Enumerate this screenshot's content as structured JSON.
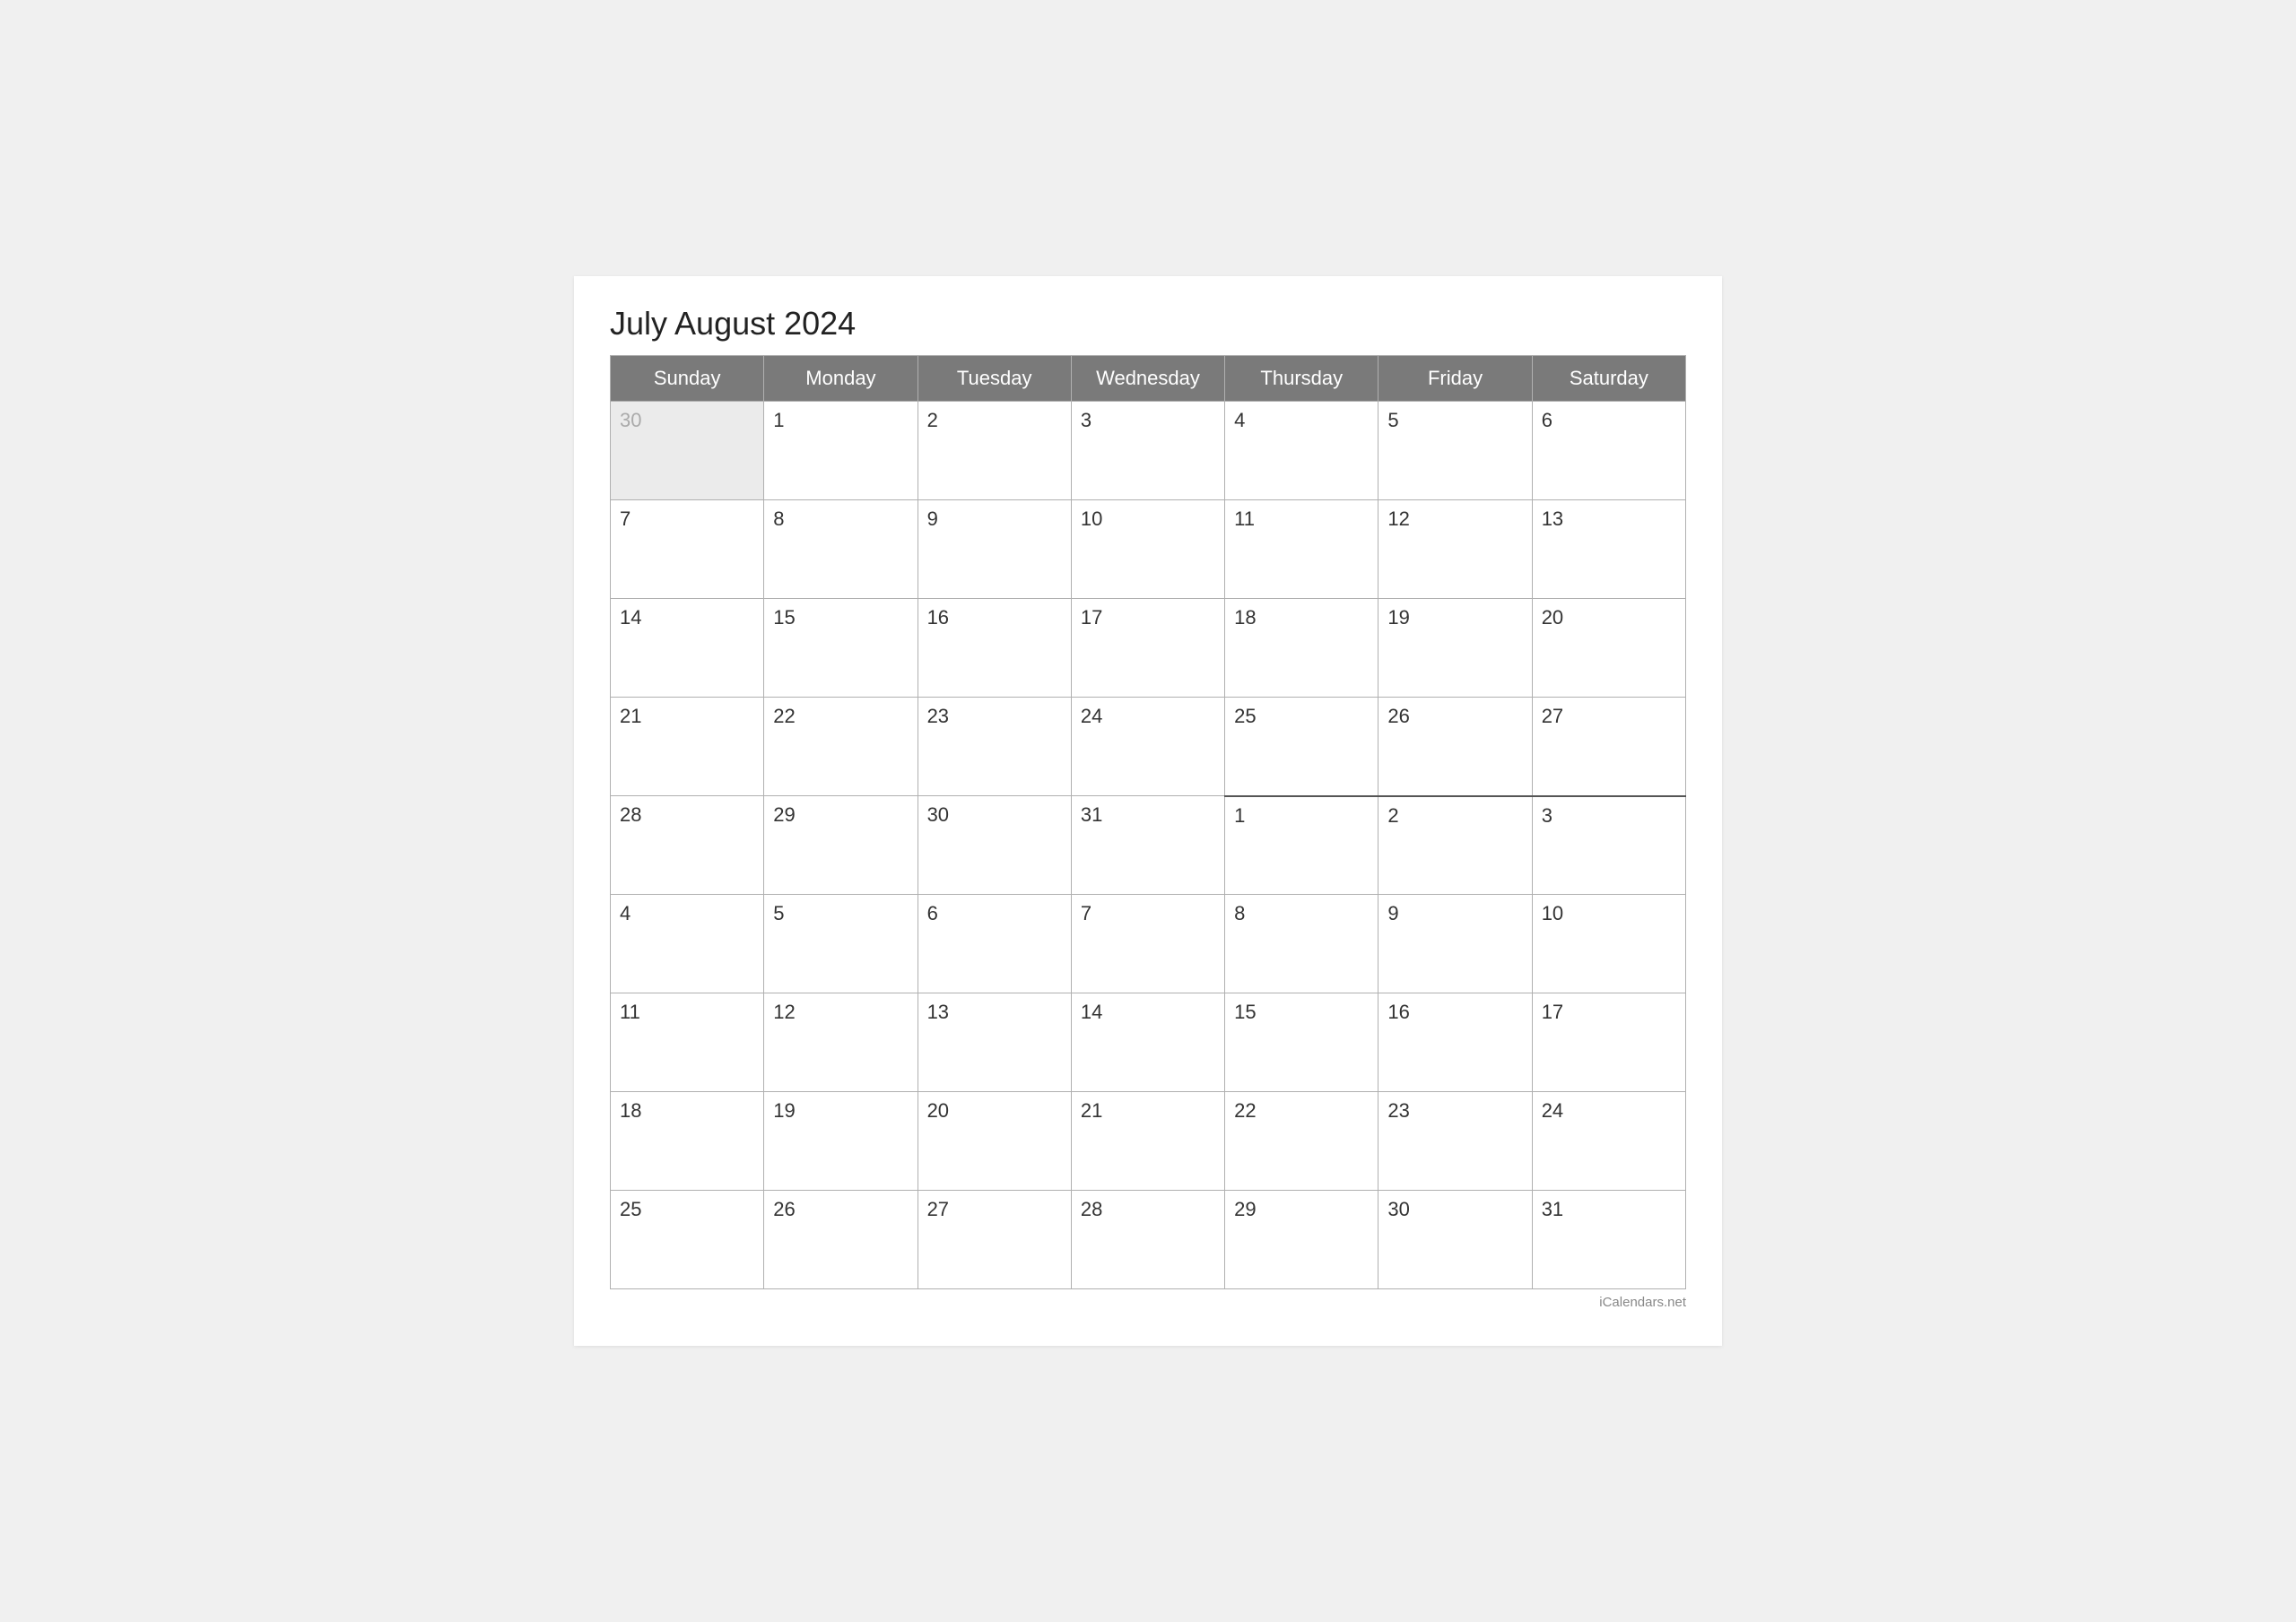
{
  "title": "July August 2024",
  "days_of_week": [
    "Sunday",
    "Monday",
    "Tuesday",
    "Wednesday",
    "Thursday",
    "Friday",
    "Saturday"
  ],
  "weeks": [
    [
      {
        "day": "30",
        "type": "prev-month"
      },
      {
        "day": "1",
        "type": "july"
      },
      {
        "day": "2",
        "type": "july"
      },
      {
        "day": "3",
        "type": "july"
      },
      {
        "day": "4",
        "type": "july"
      },
      {
        "day": "5",
        "type": "july"
      },
      {
        "day": "6",
        "type": "july"
      }
    ],
    [
      {
        "day": "7",
        "type": "july"
      },
      {
        "day": "8",
        "type": "july"
      },
      {
        "day": "9",
        "type": "july"
      },
      {
        "day": "10",
        "type": "july"
      },
      {
        "day": "11",
        "type": "july"
      },
      {
        "day": "12",
        "type": "july"
      },
      {
        "day": "13",
        "type": "july"
      }
    ],
    [
      {
        "day": "14",
        "type": "july"
      },
      {
        "day": "15",
        "type": "july"
      },
      {
        "day": "16",
        "type": "july"
      },
      {
        "day": "17",
        "type": "july"
      },
      {
        "day": "18",
        "type": "july"
      },
      {
        "day": "19",
        "type": "july"
      },
      {
        "day": "20",
        "type": "july"
      }
    ],
    [
      {
        "day": "21",
        "type": "july"
      },
      {
        "day": "22",
        "type": "july"
      },
      {
        "day": "23",
        "type": "july"
      },
      {
        "day": "24",
        "type": "july"
      },
      {
        "day": "25",
        "type": "july"
      },
      {
        "day": "26",
        "type": "july"
      },
      {
        "day": "27",
        "type": "july"
      }
    ],
    [
      {
        "day": "28",
        "type": "july"
      },
      {
        "day": "29",
        "type": "july"
      },
      {
        "day": "30",
        "type": "july"
      },
      {
        "day": "31",
        "type": "july"
      },
      {
        "day": "1",
        "type": "august"
      },
      {
        "day": "2",
        "type": "august"
      },
      {
        "day": "3",
        "type": "august"
      }
    ],
    [
      {
        "day": "4",
        "type": "august"
      },
      {
        "day": "5",
        "type": "august"
      },
      {
        "day": "6",
        "type": "august"
      },
      {
        "day": "7",
        "type": "august"
      },
      {
        "day": "8",
        "type": "august"
      },
      {
        "day": "9",
        "type": "august"
      },
      {
        "day": "10",
        "type": "august"
      }
    ],
    [
      {
        "day": "11",
        "type": "august"
      },
      {
        "day": "12",
        "type": "august"
      },
      {
        "day": "13",
        "type": "august"
      },
      {
        "day": "14",
        "type": "august"
      },
      {
        "day": "15",
        "type": "august"
      },
      {
        "day": "16",
        "type": "august"
      },
      {
        "day": "17",
        "type": "august"
      }
    ],
    [
      {
        "day": "18",
        "type": "august"
      },
      {
        "day": "19",
        "type": "august"
      },
      {
        "day": "20",
        "type": "august"
      },
      {
        "day": "21",
        "type": "august"
      },
      {
        "day": "22",
        "type": "august"
      },
      {
        "day": "23",
        "type": "august"
      },
      {
        "day": "24",
        "type": "august"
      }
    ],
    [
      {
        "day": "25",
        "type": "august"
      },
      {
        "day": "26",
        "type": "august"
      },
      {
        "day": "27",
        "type": "august"
      },
      {
        "day": "28",
        "type": "august"
      },
      {
        "day": "29",
        "type": "august"
      },
      {
        "day": "30",
        "type": "august"
      },
      {
        "day": "31",
        "type": "august"
      }
    ]
  ],
  "footer": "iCalendars.net"
}
